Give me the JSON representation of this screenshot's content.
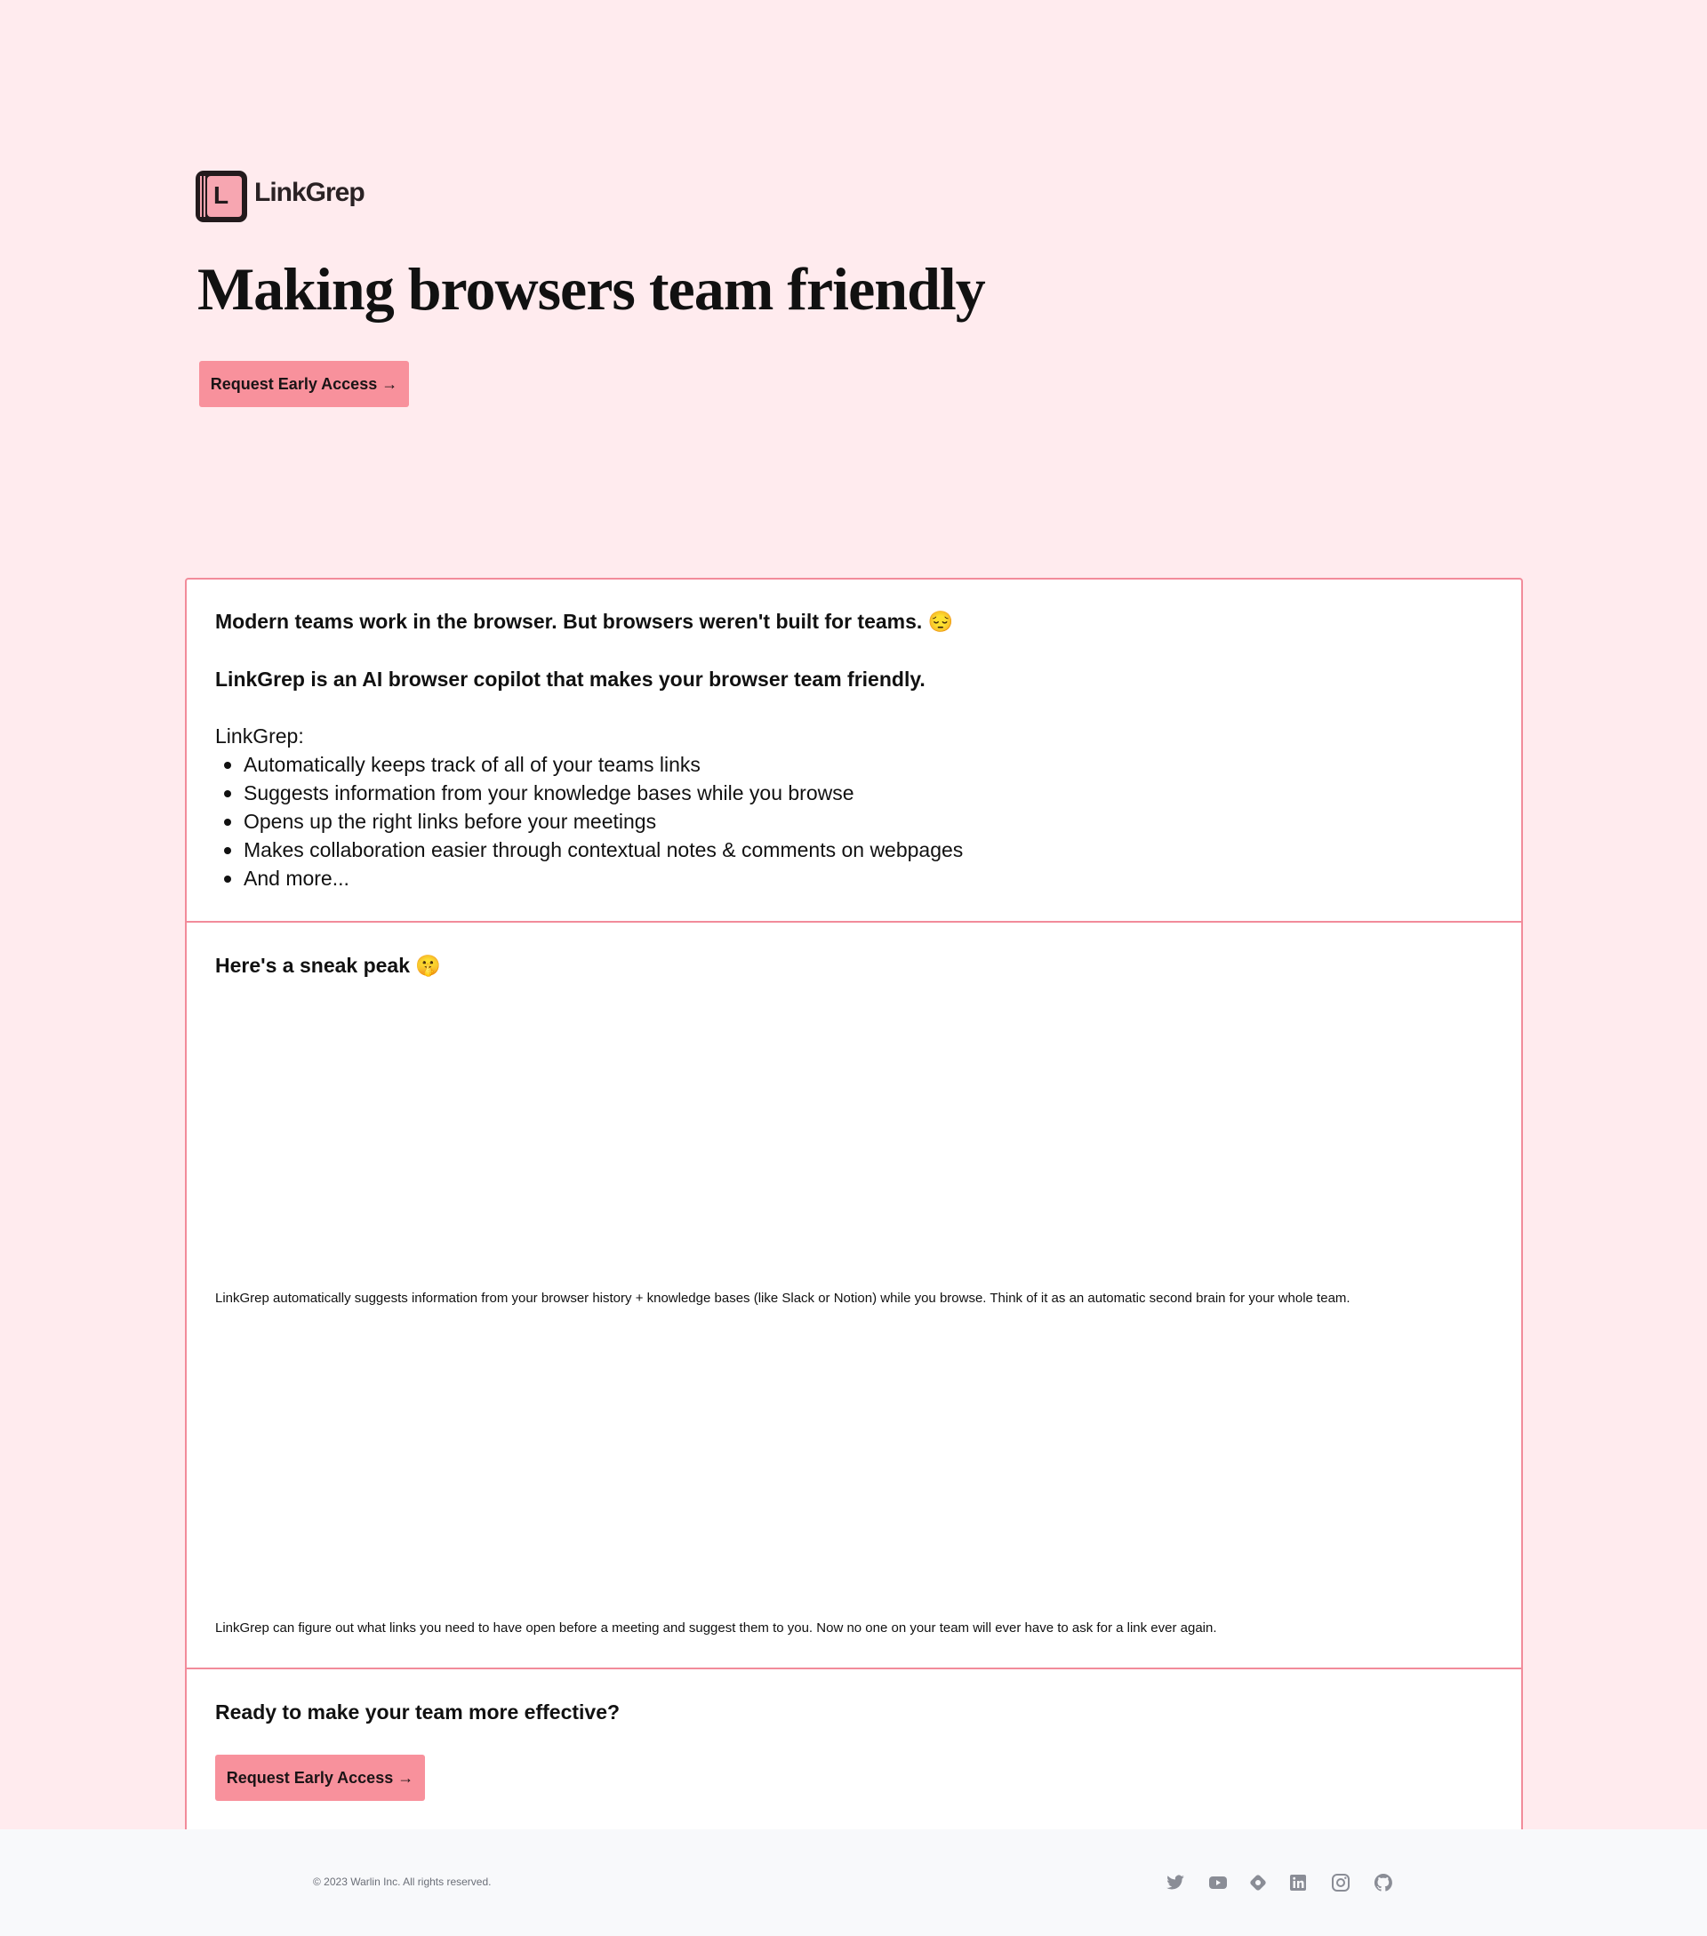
{
  "brand": {
    "name": "LinkGrep",
    "logo_letter": "L"
  },
  "hero": {
    "title": "Making browsers team friendly",
    "cta_label": "Request Early Access →"
  },
  "intro": {
    "line1": "Modern teams work in the browser. But browsers weren't built for teams. 😔",
    "line2": "LinkGrep is an AI browser copilot that makes your browser team friendly.",
    "list_title": "LinkGrep:",
    "items": [
      "Automatically keeps track of all of your teams links",
      "Suggests information from your knowledge bases while you browse",
      "Opens up the right links before your meetings",
      "Makes collaboration easier through contextual notes & comments on webpages",
      "And more..."
    ]
  },
  "preview": {
    "title": "Here's a sneak peak 🤫",
    "caption1": "LinkGrep automatically suggests information from your browser history + knowledge bases (like Slack or Notion) while you browse. Think of it as an automatic second brain for your whole team.",
    "caption2": "LinkGrep can figure out what links you need to have open before a meeting and suggest them to you. Now no one on your team will ever have to ask for a link ever again."
  },
  "cta": {
    "title": "Ready to make your team more effective?",
    "button_label": "Request Early Access →"
  },
  "footer": {
    "copyright": "© 2023 Warlin Inc. All rights reserved.",
    "social": [
      "twitter-icon",
      "youtube-icon",
      "diamond-icon",
      "linkedin-icon",
      "instagram-icon",
      "github-icon"
    ]
  },
  "colors": {
    "background": "#ffebee",
    "accent": "#f8919c",
    "border": "#f28b9a",
    "footer": "#f8f9fb",
    "icon": "#8a8d96"
  }
}
